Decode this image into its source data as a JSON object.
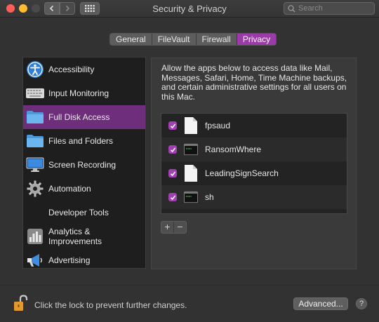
{
  "window": {
    "title": "Security & Privacy"
  },
  "search": {
    "placeholder": "Search"
  },
  "tabs": [
    {
      "label": "General"
    },
    {
      "label": "FileVault"
    },
    {
      "label": "Firewall"
    },
    {
      "label": "Privacy",
      "active": true
    }
  ],
  "sidebar": {
    "items": [
      {
        "label": "Accessibility",
        "icon": "accessibility-icon"
      },
      {
        "label": "Input Monitoring",
        "icon": "keyboard-icon"
      },
      {
        "label": "Full Disk Access",
        "icon": "folder-icon",
        "active": true
      },
      {
        "label": "Files and Folders",
        "icon": "folder-icon"
      },
      {
        "label": "Screen Recording",
        "icon": "display-icon"
      },
      {
        "label": "Automation",
        "icon": "gear-icon"
      },
      {
        "label": "Developer Tools",
        "icon": ""
      },
      {
        "label": "Analytics & Improvements",
        "icon": "analytics-icon"
      },
      {
        "label": "Advertising",
        "icon": "megaphone-icon"
      }
    ]
  },
  "panel": {
    "description": "Allow the apps below to access data like Mail, Messages, Safari, Home, Time Machine backups, and certain administrative settings for all users on this Mac.",
    "apps": [
      {
        "name": "fpsaud",
        "checked": true,
        "icon": "document-icon"
      },
      {
        "name": "RansomWhere",
        "checked": true,
        "icon": "terminal-icon"
      },
      {
        "name": "LeadingSignSearch",
        "checked": true,
        "icon": "document-icon"
      },
      {
        "name": "sh",
        "checked": true,
        "icon": "terminal-icon"
      }
    ],
    "add_label": "+",
    "remove_label": "−"
  },
  "footer": {
    "lock_text": "Click the lock to prevent further changes.",
    "advanced_label": "Advanced...",
    "help_label": "?"
  },
  "colors": {
    "accent": "#9b3aa8",
    "selection": "#6e2e7c",
    "folder": "#5aa9e6"
  }
}
